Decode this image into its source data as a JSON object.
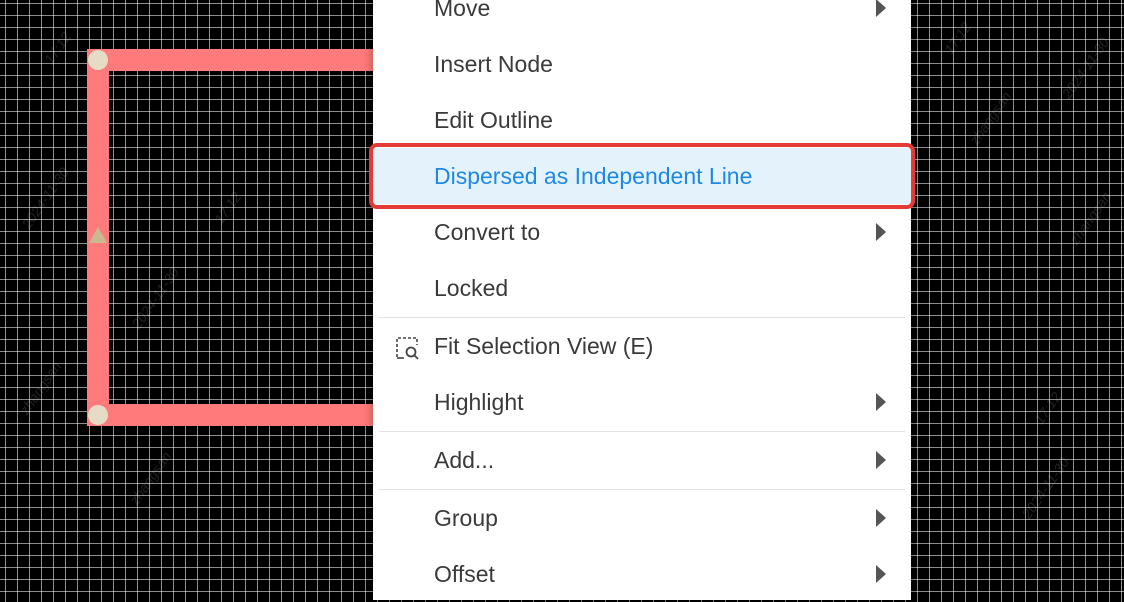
{
  "canvas": {
    "watermarks": [
      "17:12",
      "2024-11-30",
      "zhangsan",
      "17:12",
      "2024-11-30",
      "zhangsan",
      "17:12",
      "2024-11-30",
      "zhangsan",
      "17:12",
      "2024-11-30",
      "zhangsan"
    ]
  },
  "shape": {
    "stroke_color": "#ff7b7b",
    "node_color": "#e6dcc6"
  },
  "context_menu": {
    "items": [
      {
        "label": "Move",
        "has_submenu": true
      },
      {
        "label": "Insert Node",
        "has_submenu": false
      },
      {
        "label": "Edit Outline",
        "has_submenu": false
      },
      {
        "label": "Dispersed as Independent Line",
        "has_submenu": false,
        "highlighted": true
      },
      {
        "label": "Convert to",
        "has_submenu": true
      },
      {
        "label": "Locked",
        "has_submenu": false
      },
      {
        "label": "Fit Selection View (E)",
        "has_submenu": false,
        "icon": "fit-selection-icon"
      },
      {
        "label": "Highlight",
        "has_submenu": true
      },
      {
        "label": "Add...",
        "has_submenu": true
      },
      {
        "label": "Group",
        "has_submenu": true
      },
      {
        "label": "Offset",
        "has_submenu": true
      }
    ],
    "highlight_color": "#e53935",
    "active_text_color": "#1e88e5"
  }
}
